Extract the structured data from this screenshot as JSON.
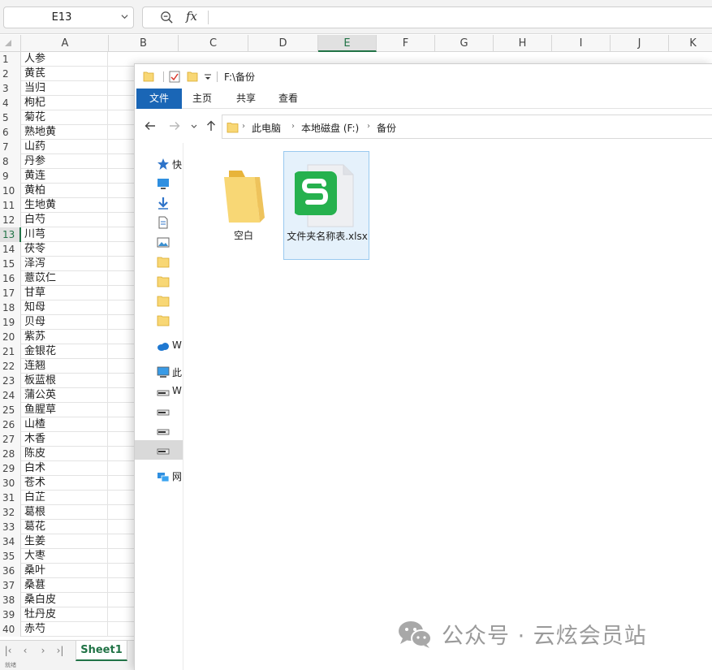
{
  "spreadsheet": {
    "name_box": "E13",
    "fx_label": "fx",
    "columns": [
      "A",
      "B",
      "C",
      "D",
      "E",
      "F",
      "G",
      "H",
      "I",
      "J",
      "K"
    ],
    "active_column": "E",
    "active_row": 13,
    "rows": [
      {
        "num": "1",
        "a": "人参"
      },
      {
        "num": "2",
        "a": "黄芪"
      },
      {
        "num": "3",
        "a": "当归"
      },
      {
        "num": "4",
        "a": "枸杞"
      },
      {
        "num": "5",
        "a": "菊花"
      },
      {
        "num": "6",
        "a": "熟地黄"
      },
      {
        "num": "7",
        "a": "山药"
      },
      {
        "num": "8",
        "a": "丹参"
      },
      {
        "num": "9",
        "a": "黄连"
      },
      {
        "num": "10",
        "a": "黄柏"
      },
      {
        "num": "11",
        "a": "生地黄"
      },
      {
        "num": "12",
        "a": "白芍"
      },
      {
        "num": "13",
        "a": "川芎"
      },
      {
        "num": "14",
        "a": "茯苓"
      },
      {
        "num": "15",
        "a": "泽泻"
      },
      {
        "num": "16",
        "a": "薏苡仁"
      },
      {
        "num": "17",
        "a": "甘草"
      },
      {
        "num": "18",
        "a": "知母"
      },
      {
        "num": "19",
        "a": "贝母"
      },
      {
        "num": "20",
        "a": "紫苏"
      },
      {
        "num": "21",
        "a": "金银花"
      },
      {
        "num": "22",
        "a": "连翘"
      },
      {
        "num": "23",
        "a": "板蓝根"
      },
      {
        "num": "24",
        "a": "蒲公英"
      },
      {
        "num": "25",
        "a": "鱼腥草"
      },
      {
        "num": "26",
        "a": "山楂"
      },
      {
        "num": "27",
        "a": "木香"
      },
      {
        "num": "28",
        "a": "陈皮"
      },
      {
        "num": "29",
        "a": "白术"
      },
      {
        "num": "30",
        "a": "苍术"
      },
      {
        "num": "31",
        "a": "白芷"
      },
      {
        "num": "32",
        "a": "葛根"
      },
      {
        "num": "33",
        "a": "葛花"
      },
      {
        "num": "34",
        "a": "生姜"
      },
      {
        "num": "35",
        "a": "大枣"
      },
      {
        "num": "36",
        "a": "桑叶"
      },
      {
        "num": "37",
        "a": "桑葚"
      },
      {
        "num": "38",
        "a": "桑白皮"
      },
      {
        "num": "39",
        "a": "牡丹皮"
      },
      {
        "num": "40",
        "a": "赤芍"
      }
    ],
    "sheet_tab": "Sheet1",
    "status_text": "就绪"
  },
  "explorer": {
    "title": "F:\\备份",
    "ribbon_tabs": [
      "文件",
      "主页",
      "共享",
      "查看"
    ],
    "breadcrumb": [
      "此电脑",
      "本地磁盘 (F:)",
      "备份"
    ],
    "nav_items": [
      {
        "icon": "star-icon",
        "label": "快"
      },
      {
        "icon": "monitor-icon",
        "label": ""
      },
      {
        "icon": "download-arrow-icon",
        "label": ""
      },
      {
        "icon": "document-icon",
        "label": ""
      },
      {
        "icon": "picture-icon",
        "label": ""
      },
      {
        "icon": "folder-icon",
        "label": ""
      },
      {
        "icon": "folder-icon",
        "label": ""
      },
      {
        "icon": "folder-icon",
        "label": ""
      },
      {
        "icon": "folder-icon",
        "label": ""
      },
      {
        "icon": "cloud-icon",
        "label": "W"
      },
      {
        "icon": "computer-icon",
        "label": "此"
      },
      {
        "icon": "drive-icon",
        "label": "W"
      },
      {
        "icon": "drive-icon",
        "label": ""
      },
      {
        "icon": "drive-icon",
        "label": ""
      },
      {
        "icon": "drive-icon",
        "label": ""
      },
      {
        "icon": "network-icon",
        "label": "网"
      }
    ],
    "files": [
      {
        "icon": "folder-icon",
        "name": "空白"
      },
      {
        "icon": "spreadsheet-file-icon",
        "name": "文件夹名称表.xlsx"
      }
    ]
  },
  "watermark": {
    "text": "公众号 · 云炫会员站"
  },
  "colors": {
    "excel_green": "#217346",
    "file_tab_blue": "#1a66b6",
    "wps_green": "#26b14e",
    "folder_yellow": "#f8d775"
  }
}
